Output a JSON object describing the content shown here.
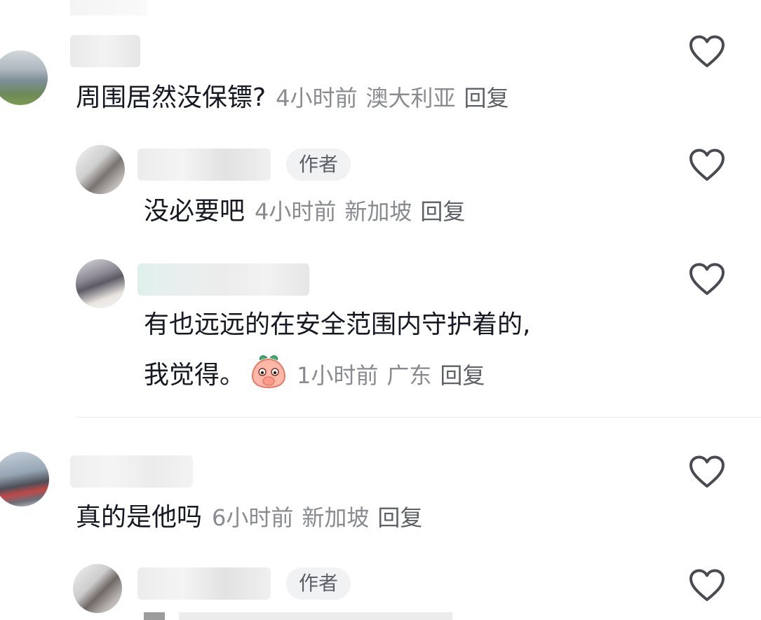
{
  "comments": [
    {
      "text": "周围居然没保镖?",
      "time": "4小时前",
      "location": "澳大利亚",
      "reply_label": "回复",
      "replies": [
        {
          "badge": "作者",
          "text": "没必要吧",
          "time": "4小时前",
          "location": "新加坡",
          "reply_label": "回复"
        },
        {
          "text_line1": "有也远远的在安全范围内守护着的,",
          "text_line2": "我觉得。",
          "emoji": "peach-covering-mouth-emoji",
          "time": "1小时前",
          "location": "广东",
          "reply_label": "回复"
        }
      ]
    },
    {
      "text": "真的是他吗",
      "time": "6小时前",
      "location": "新加坡",
      "reply_label": "回复",
      "replies": [
        {
          "badge": "作者"
        }
      ]
    }
  ],
  "colors": {
    "text_primary": "#161823",
    "text_meta": "#8a8b91",
    "badge_bg": "#f1f2f4",
    "heart_outline": "#4a4b52"
  },
  "icons": [
    "heart-outline-icon"
  ]
}
